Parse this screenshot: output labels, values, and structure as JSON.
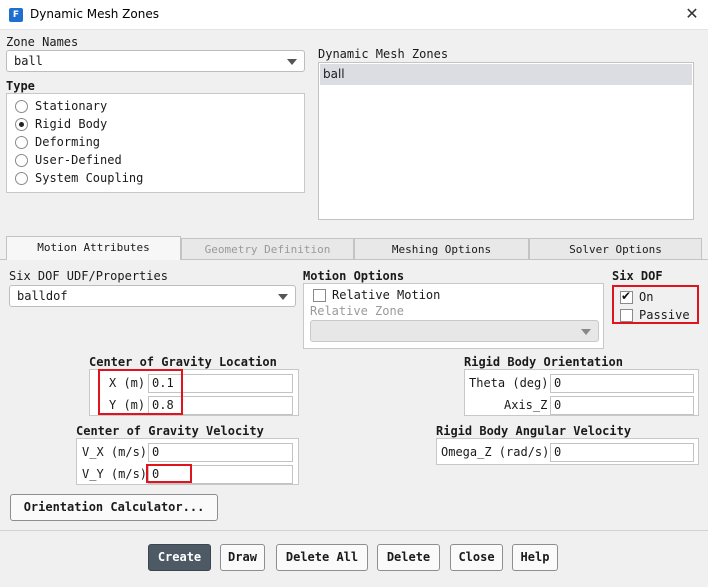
{
  "window": {
    "title": "Dynamic Mesh Zones",
    "app_icon": "F"
  },
  "zone_names": {
    "label": "Zone Names",
    "value": "ball"
  },
  "type": {
    "label": "Type",
    "options": [
      "Stationary",
      "Rigid Body",
      "Deforming",
      "User-Defined",
      "System Coupling"
    ],
    "selected": "Rigid Body"
  },
  "dynamic_mesh_zones": {
    "label": "Dynamic Mesh Zones",
    "items": [
      "ball"
    ]
  },
  "tabs": [
    {
      "label": "Motion Attributes",
      "state": "active"
    },
    {
      "label": "Geometry Definition",
      "state": "disabled"
    },
    {
      "label": "Meshing Options",
      "state": "normal"
    },
    {
      "label": "Solver Options",
      "state": "normal"
    }
  ],
  "six_dof_udf": {
    "label": "Six DOF UDF/Properties",
    "value": "balldof"
  },
  "motion_options": {
    "label": "Motion Options",
    "relative_motion_label": "Relative Motion",
    "relative_motion_checked": false,
    "relative_zone_label": "Relative Zone",
    "relative_zone_value": ""
  },
  "six_dof": {
    "label": "Six DOF",
    "on_label": "On",
    "on_checked": true,
    "passive_label": "Passive",
    "passive_checked": false
  },
  "cog_location": {
    "label": "Center of Gravity Location",
    "x_label": "X (m)",
    "x_value": "0.1",
    "y_label": "Y (m)",
    "y_value": "0.8"
  },
  "cog_velocity": {
    "label": "Center of Gravity Velocity",
    "vx_label": "V_X (m/s)",
    "vx_value": "0",
    "vy_label": "V_Y (m/s)",
    "vy_value": "0"
  },
  "rb_orientation": {
    "label": "Rigid Body Orientation",
    "theta_label": "Theta (deg)",
    "theta_value": "0",
    "axis_label": "Axis_Z",
    "axis_value": "0"
  },
  "rb_angular_velocity": {
    "label": "Rigid Body Angular Velocity",
    "omega_label": "Omega_Z (rad/s)",
    "omega_value": "0"
  },
  "orientation_calculator": "Orientation Calculator...",
  "buttons": {
    "create": "Create",
    "draw": "Draw",
    "delete_all": "Delete All",
    "delete": "Delete",
    "close": "Close",
    "help": "Help"
  },
  "colors": {
    "highlight": "#e0141c",
    "primary_button": "#4d5a66",
    "selection": "#dcdde3"
  }
}
